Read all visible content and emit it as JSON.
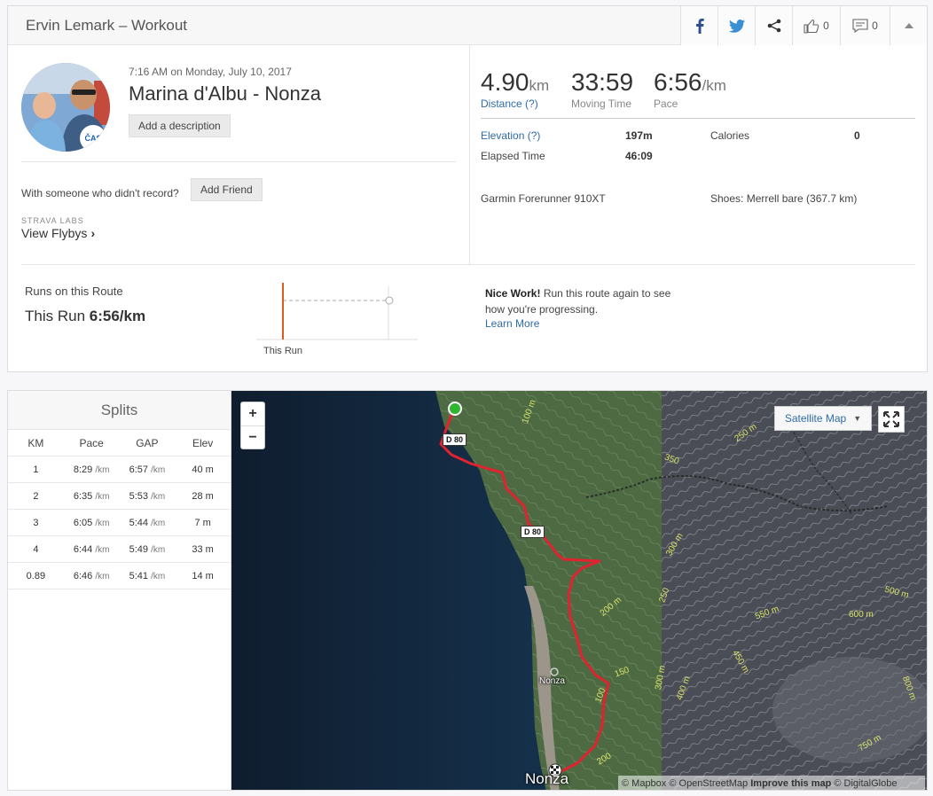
{
  "header": {
    "title": "Ervin Lemark – Workout",
    "kudos_count": "0",
    "comment_count": "0"
  },
  "activity": {
    "datetime": "7:16 AM on Monday, July 10, 2017",
    "name": "Marina d'Albu - Nonza",
    "add_description": "Add a description",
    "with_someone": "With someone who didn't record?",
    "add_friend": "Add Friend",
    "labs_label": "STRAVA LABS",
    "flybys": "View Flybys",
    "avatar_badge": "ČAS"
  },
  "stats": {
    "distance_value": "4.90",
    "distance_unit": "km",
    "distance_label": "Distance (?)",
    "moving_time_value": "33:59",
    "moving_time_label": "Moving Time",
    "pace_value": "6:56",
    "pace_unit": "/km",
    "pace_label": "Pace",
    "elevation_label": "Elevation (?)",
    "elevation_value": "197m",
    "calories_label": "Calories",
    "calories_value": "0",
    "elapsed_label": "Elapsed Time",
    "elapsed_value": "46:09",
    "device": "Garmin Forerunner 910XT",
    "shoes": "Shoes: Merrell bare (367.7 km)"
  },
  "route": {
    "title": "Runs on this Route",
    "run_prefix": "This Run",
    "run_pace": "6:56/km",
    "chart_label": "This Run",
    "nice_bold": "Nice Work!",
    "nice_text": "Run this route again to see how you're progressing.",
    "learn_more": "Learn More"
  },
  "splits": {
    "title": "Splits",
    "columns": [
      "KM",
      "Pace",
      "GAP",
      "Elev"
    ],
    "pace_unit": "/km",
    "rows": [
      {
        "km": "1",
        "pace": "8:29",
        "gap": "6:57",
        "elev": "40 m"
      },
      {
        "km": "2",
        "pace": "6:35",
        "gap": "5:53",
        "elev": "28 m"
      },
      {
        "km": "3",
        "pace": "6:05",
        "gap": "5:44",
        "elev": "7 m"
      },
      {
        "km": "4",
        "pace": "6:44",
        "gap": "5:49",
        "elev": "33 m"
      },
      {
        "km": "0.89",
        "pace": "6:46",
        "gap": "5:41",
        "elev": "14 m"
      }
    ]
  },
  "map": {
    "zoom_in": "+",
    "zoom_out": "−",
    "type_label": "Satellite Map",
    "road_label_1": "D 80",
    "road_label_2": "D 80",
    "town_small": "Nonza",
    "town_large": "Nonza",
    "attribution_1": "© Mapbox © OpenStreetMap",
    "attribution_2": "Improve this map",
    "attribution_3": "© DigitalGlobe",
    "contours": [
      "100 m",
      "350",
      "250 m",
      "300 m",
      "200 m",
      "250",
      "550 m",
      "600 m",
      "500 m",
      "450 m",
      "400 m",
      "150",
      "100",
      "300 m",
      "200",
      "750 m",
      "800 m"
    ]
  },
  "colors": {
    "link": "#2f6ba8",
    "route_line": "#e0232f",
    "start_marker": "#2fb52f",
    "chart_bar": "#e05a1c"
  }
}
